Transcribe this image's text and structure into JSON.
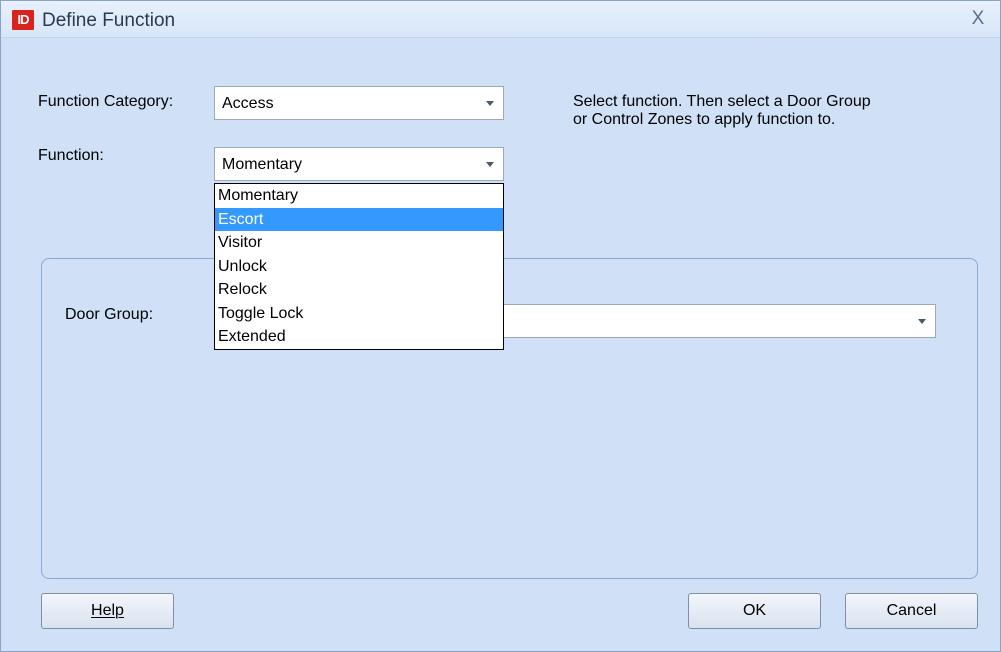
{
  "window": {
    "title": "Define Function",
    "app_icon_text": "ID",
    "close_label": "X"
  },
  "form": {
    "category_label": "Function Category:",
    "category_value": "Access",
    "function_label": "Function:",
    "function_value": "Momentary",
    "hint_line1": "Select function. Then select a Door Group",
    "hint_line2": "or Control Zones to apply function to."
  },
  "function_options": [
    "Momentary",
    "Escort",
    "Visitor",
    "Unlock",
    "Relock",
    "Toggle Lock",
    "Extended"
  ],
  "highlighted_option": "Escort",
  "door_group": {
    "label": "Door Group:",
    "value": ""
  },
  "buttons": {
    "help": "Help",
    "ok": "OK",
    "cancel": "Cancel"
  }
}
